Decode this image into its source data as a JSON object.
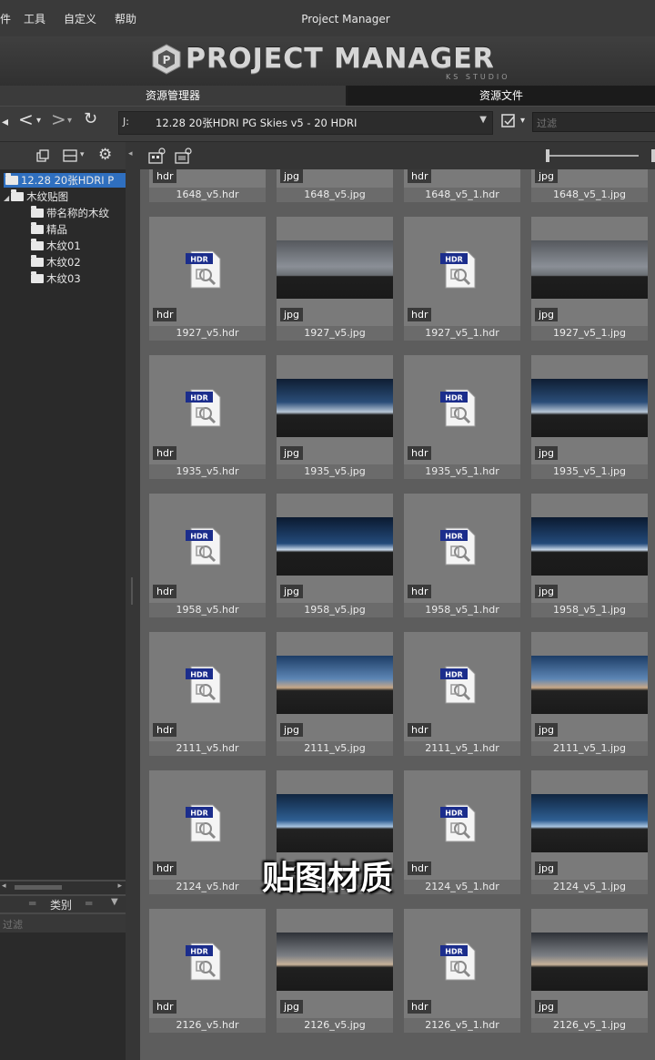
{
  "menu": {
    "items": [
      "件",
      "工具",
      "自定义",
      "帮助"
    ],
    "window_title": "Project Manager"
  },
  "banner": {
    "logo_text": "PROJECT MANAGER",
    "logo_sub": "KS STUDIO"
  },
  "tabs": [
    "资源管理器",
    "资源文件"
  ],
  "path": {
    "drive": "J:",
    "value": "12.28 20张HDRI PG Skies v5 - 20 HDRI"
  },
  "filter_placeholder": "过滤",
  "tree": [
    {
      "label": "12.28 20张HDRI P",
      "level": 0,
      "selected": true
    },
    {
      "label": "木纹贴图",
      "level": 0
    },
    {
      "label": "带名称的木纹",
      "level": 1
    },
    {
      "label": "精品",
      "level": 1
    },
    {
      "label": "木纹01",
      "level": 1
    },
    {
      "label": "木纹02",
      "level": 1
    },
    {
      "label": "木纹03",
      "level": 1
    }
  ],
  "category_header": "类别",
  "category_filter_placeholder": "过滤",
  "files": [
    {
      "name": "1648_v5.hdr",
      "ext": "hdr"
    },
    {
      "name": "1648_v5.jpg",
      "ext": "jpg"
    },
    {
      "name": "1648_v5_1.hdr",
      "ext": "hdr"
    },
    {
      "name": "1648_v5_1.jpg",
      "ext": "jpg"
    },
    {
      "name": "1927_v5.hdr",
      "ext": "hdr"
    },
    {
      "name": "1927_v5.jpg",
      "ext": "jpg"
    },
    {
      "name": "1927_v5_1.hdr",
      "ext": "hdr"
    },
    {
      "name": "1927_v5_1.jpg",
      "ext": "jpg"
    },
    {
      "name": "1935_v5.hdr",
      "ext": "hdr"
    },
    {
      "name": "1935_v5.jpg",
      "ext": "jpg"
    },
    {
      "name": "1935_v5_1.hdr",
      "ext": "hdr"
    },
    {
      "name": "1935_v5_1.jpg",
      "ext": "jpg"
    },
    {
      "name": "1958_v5.hdr",
      "ext": "hdr"
    },
    {
      "name": "1958_v5.jpg",
      "ext": "jpg"
    },
    {
      "name": "1958_v5_1.hdr",
      "ext": "hdr"
    },
    {
      "name": "1958_v5_1.jpg",
      "ext": "jpg"
    },
    {
      "name": "2111_v5.hdr",
      "ext": "hdr"
    },
    {
      "name": "2111_v5.jpg",
      "ext": "jpg"
    },
    {
      "name": "2111_v5_1.hdr",
      "ext": "hdr"
    },
    {
      "name": "2111_v5_1.jpg",
      "ext": "jpg"
    },
    {
      "name": "2124_v5.hdr",
      "ext": "hdr"
    },
    {
      "name": "2124_v5.jpg",
      "ext": "jpg"
    },
    {
      "name": "2124_v5_1.hdr",
      "ext": "hdr"
    },
    {
      "name": "2124_v5_1.jpg",
      "ext": "jpg"
    },
    {
      "name": "2126_v5.hdr",
      "ext": "hdr"
    },
    {
      "name": "2126_v5.jpg",
      "ext": "jpg"
    },
    {
      "name": "2126_v5_1.hdr",
      "ext": "hdr"
    },
    {
      "name": "2126_v5_1.jpg",
      "ext": "jpg"
    }
  ],
  "hdr_icon_label": "HDR",
  "subtitle": "贴图材质",
  "colors": {
    "selection": "#2f6fbf",
    "panel": "#2a2a2a",
    "grid_bg": "#5d5d5d"
  }
}
